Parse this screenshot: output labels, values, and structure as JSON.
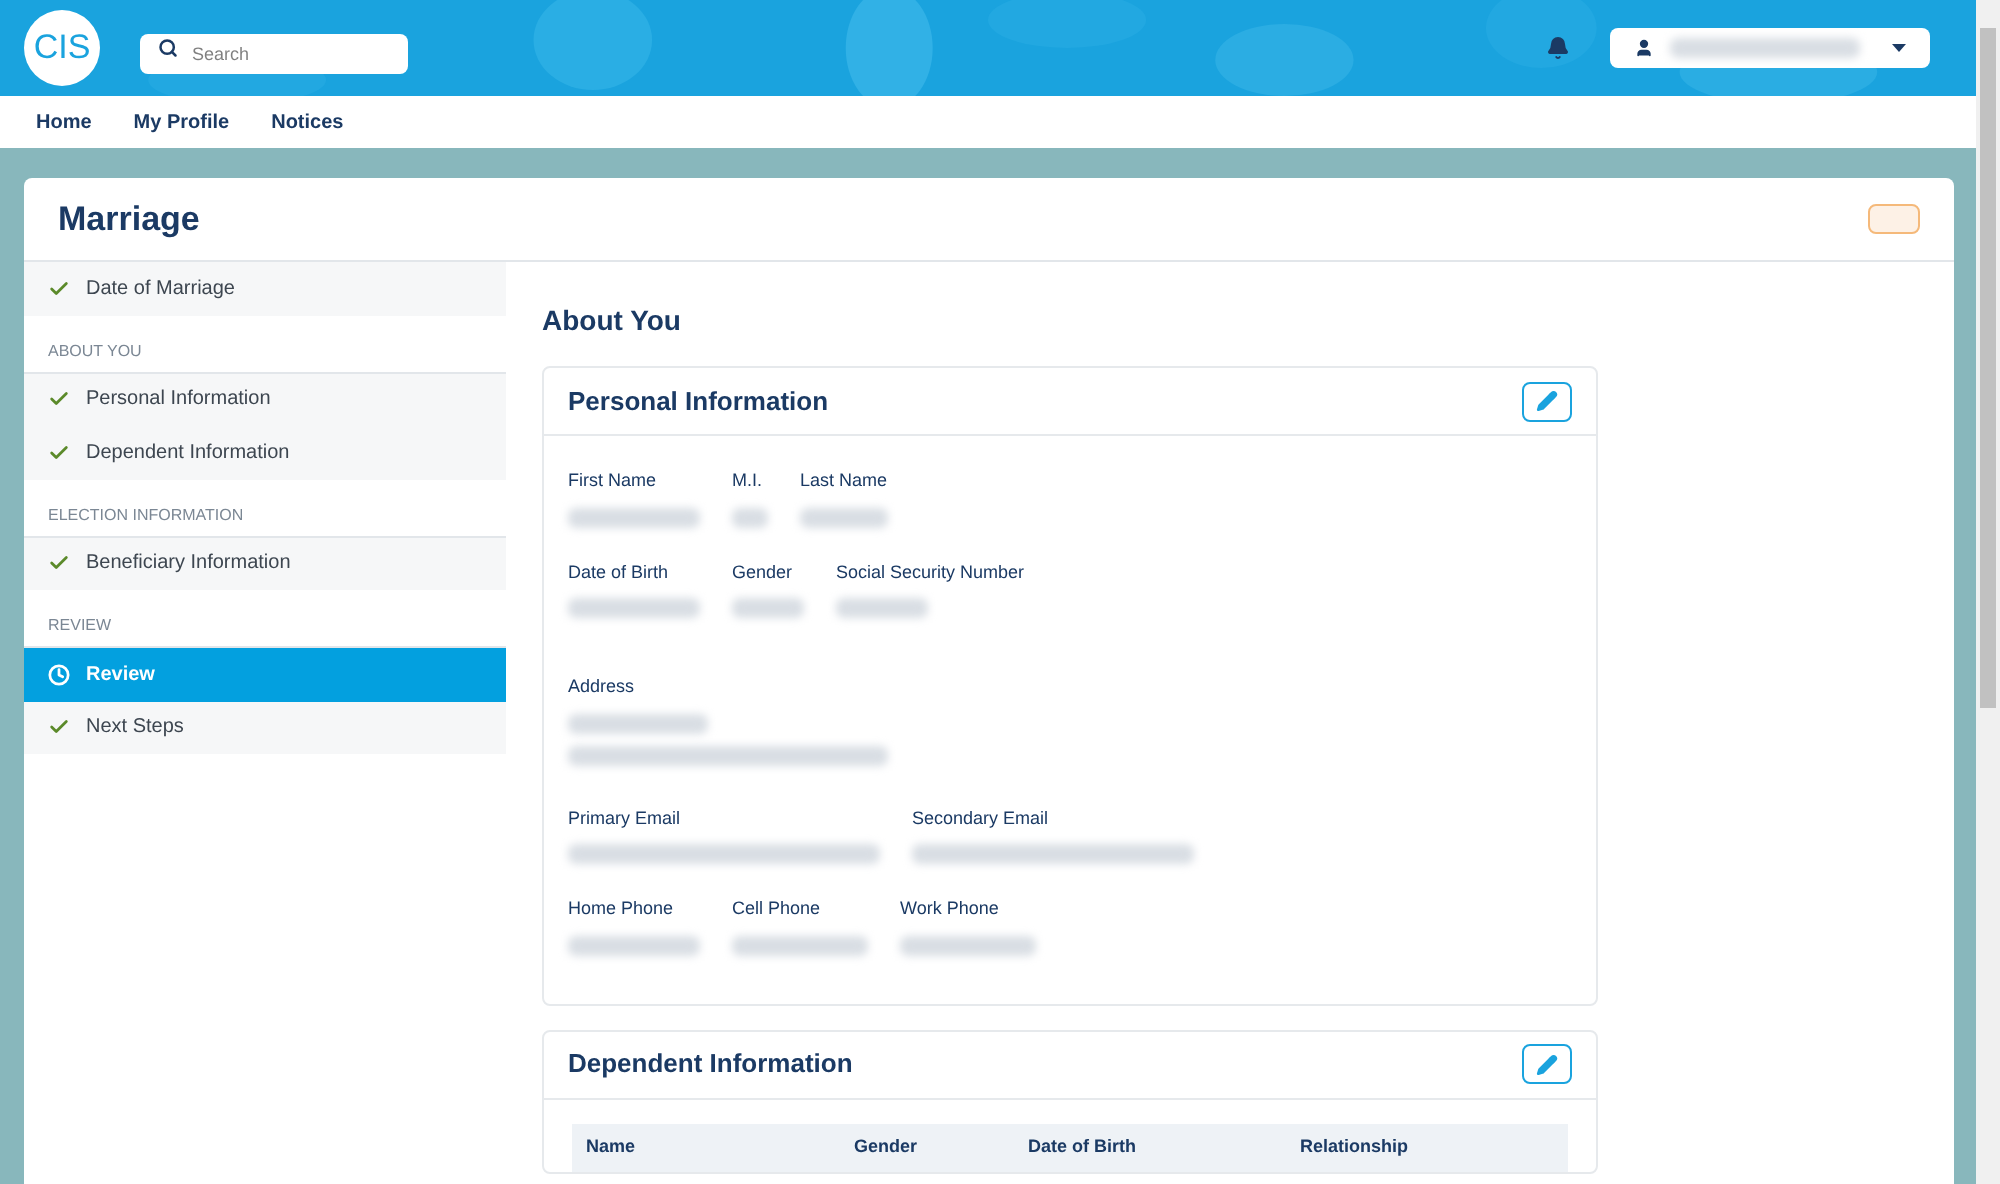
{
  "header": {
    "logo": "CIS",
    "search": {
      "placeholder": "Search"
    }
  },
  "nav": [
    {
      "label": "Home"
    },
    {
      "label": "My Profile"
    },
    {
      "label": "Notices"
    }
  ],
  "page": {
    "title": "Marriage"
  },
  "sidebar": {
    "items": [
      {
        "kind": "step",
        "label": "Date of Marriage",
        "completed": true,
        "selected": false
      },
      {
        "kind": "section",
        "label": "ABOUT YOU"
      },
      {
        "kind": "step",
        "label": "Personal Information",
        "completed": true,
        "selected": false
      },
      {
        "kind": "step",
        "label": "Dependent Information",
        "completed": true,
        "selected": false
      },
      {
        "kind": "section",
        "label": "ELECTION INFORMATION"
      },
      {
        "kind": "step",
        "label": "Beneficiary Information",
        "completed": true,
        "selected": false
      },
      {
        "kind": "section",
        "label": "REVIEW"
      },
      {
        "kind": "step",
        "label": "Review",
        "completed": false,
        "selected": true
      },
      {
        "kind": "step",
        "label": "Next Steps",
        "completed": true,
        "selected": false
      }
    ]
  },
  "content": {
    "heading": "About You",
    "personal": {
      "title": "Personal Information",
      "groups": [
        {
          "fields": [
            {
              "label": "First Name",
              "kind": "single"
            },
            {
              "label": "M.I.",
              "kind": "single"
            },
            {
              "label": "Last Name",
              "kind": "single"
            }
          ]
        },
        {
          "fields": [
            {
              "label": "Date of Birth",
              "kind": "single"
            },
            {
              "label": "Gender",
              "kind": "single"
            },
            {
              "label": "Social Security Number",
              "kind": "single"
            }
          ]
        },
        {
          "fields": [
            {
              "label": "Address",
              "kind": "multiline"
            }
          ]
        },
        {
          "fields": [
            {
              "label": "Primary Email",
              "kind": "single"
            },
            {
              "label": "Secondary Email",
              "kind": "single"
            }
          ]
        },
        {
          "fields": [
            {
              "label": "Home Phone",
              "kind": "single"
            },
            {
              "label": "Cell Phone",
              "kind": "single"
            },
            {
              "label": "Work Phone",
              "kind": "single"
            }
          ]
        }
      ]
    },
    "dependent": {
      "title": "Dependent Information",
      "columns": [
        "Name",
        "Gender",
        "Date of Birth",
        "Relationship"
      ]
    }
  }
}
